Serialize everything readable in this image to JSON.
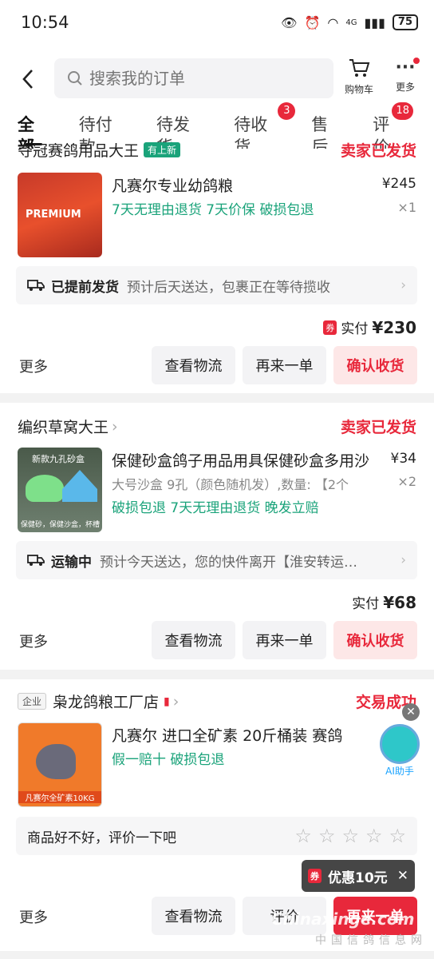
{
  "status_bar": {
    "time": "10:54",
    "signal": "4G",
    "battery": "75"
  },
  "header": {
    "search_placeholder": "搜索我的订单",
    "cart_label": "购物车",
    "more_label": "更多"
  },
  "tabs": [
    {
      "label": "全部"
    },
    {
      "label": "待付款"
    },
    {
      "label": "待发货"
    },
    {
      "label": "待收货",
      "badge": "3"
    },
    {
      "label": "售后"
    },
    {
      "label": "评价",
      "badge": "18"
    }
  ],
  "orders": [
    {
      "shop": "夺冠赛鸽用品大王",
      "shop_tag": "有上新",
      "status": "卖家已发货",
      "title": "凡赛尔专业幼鸽粮",
      "price": "¥245",
      "qty": "×1",
      "tags": "7天无理由退货  7天价保  破损包退",
      "thumb_text": "PREMIUM",
      "logistics_label": "已提前发货",
      "logistics_desc": "预计后天送达，包裹正在等待揽收",
      "paid_prefix": "实付",
      "paid_amount": "¥230",
      "coupon": "券",
      "more": "更多",
      "btn1": "查看物流",
      "btn2": "再来一单",
      "btn3": "确认收货"
    },
    {
      "shop": "编织草窝大王",
      "status": "卖家已发货",
      "title": "保健砂盒鸽子用品用具保健砂盒多用沙",
      "price": "¥34",
      "qty": "×2",
      "spec": "大号沙盒 9孔（颜色随机发）,数量: 【2个",
      "tags": "破损包退  7天无理由退货  晚发立赔",
      "thumb_text": "新款九孔砂盒",
      "thumb_caption": "保健砂，保健沙盒，杯槽",
      "logistics_label": "运输中",
      "logistics_desc": "预计今天送达，您的快件离开【淮安转运…",
      "paid_prefix": "实付",
      "paid_amount": "¥68",
      "more": "更多",
      "btn1": "查看物流",
      "btn2": "再来一单",
      "btn3": "确认收货"
    },
    {
      "shop_tag": "企业",
      "shop": "枭龙鸽粮工厂店",
      "status": "交易成功",
      "title": "凡赛尔 进口全矿素 20斤桶装 赛鸽",
      "tags": "假一赔十  破损包退",
      "thumb_caption": "凡赛尔全矿素10KG",
      "review_prompt": "商品好不好，评价一下吧",
      "more": "更多",
      "btn1": "查看物流",
      "btn2": "评价",
      "btn3": "再来一单"
    }
  ],
  "toast": {
    "coupon": "券",
    "text": "优惠10元"
  },
  "ai_label": "AI助手",
  "watermark": {
    "line1": "Chinaxinge.com",
    "line2": "中国信鸽信息网"
  }
}
